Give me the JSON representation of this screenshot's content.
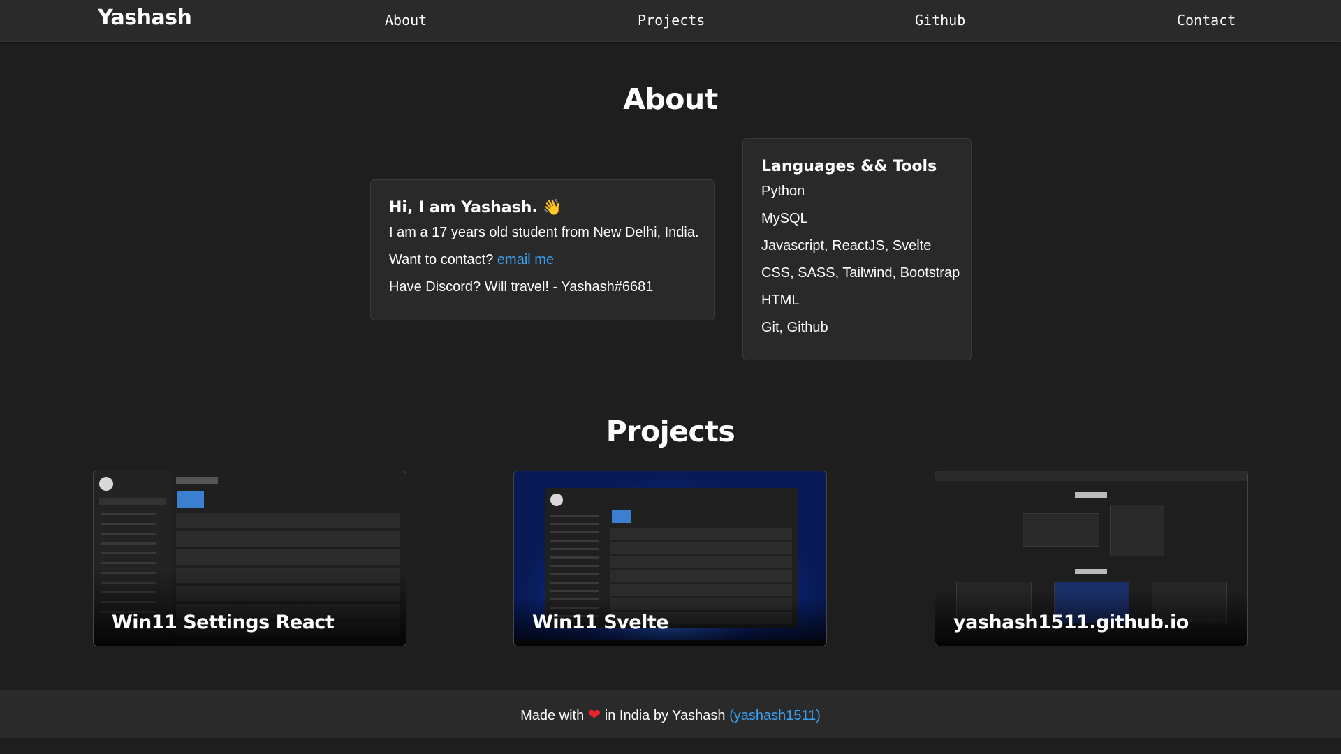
{
  "nav": {
    "brand": "Yashash",
    "links": [
      "About",
      "Projects",
      "Github",
      "Contact"
    ]
  },
  "about": {
    "title": "About",
    "intro_card": {
      "heading": "Hi, I am Yashash.",
      "wave": "👋",
      "line1": "I am a 17 years old student from New Delhi, India.",
      "contact_prefix": "Want to contact?",
      "contact_link": "email me",
      "discord": "Have Discord? Will travel! - Yashash#6681"
    },
    "tools_card": {
      "heading": "Languages && Tools",
      "items": [
        "Python",
        "MySQL",
        "Javascript, ReactJS, Svelte",
        "CSS, SASS, Tailwind, Bootstrap",
        "HTML",
        "Git, Github"
      ]
    }
  },
  "projects": {
    "title": "Projects",
    "items": [
      {
        "title": "Win11 Settings React"
      },
      {
        "title": "Win11 Svelte"
      },
      {
        "title": "yashash1511.github.io"
      }
    ]
  },
  "footer": {
    "made_with": "Made with",
    "heart": "❤",
    "in_india": "in India by Yashash",
    "handle": "(yashash1511)"
  },
  "colors": {
    "background": "#1e1e1e",
    "surface": "#292929",
    "link": "#3aa0f0",
    "heart": "#e8242c"
  }
}
